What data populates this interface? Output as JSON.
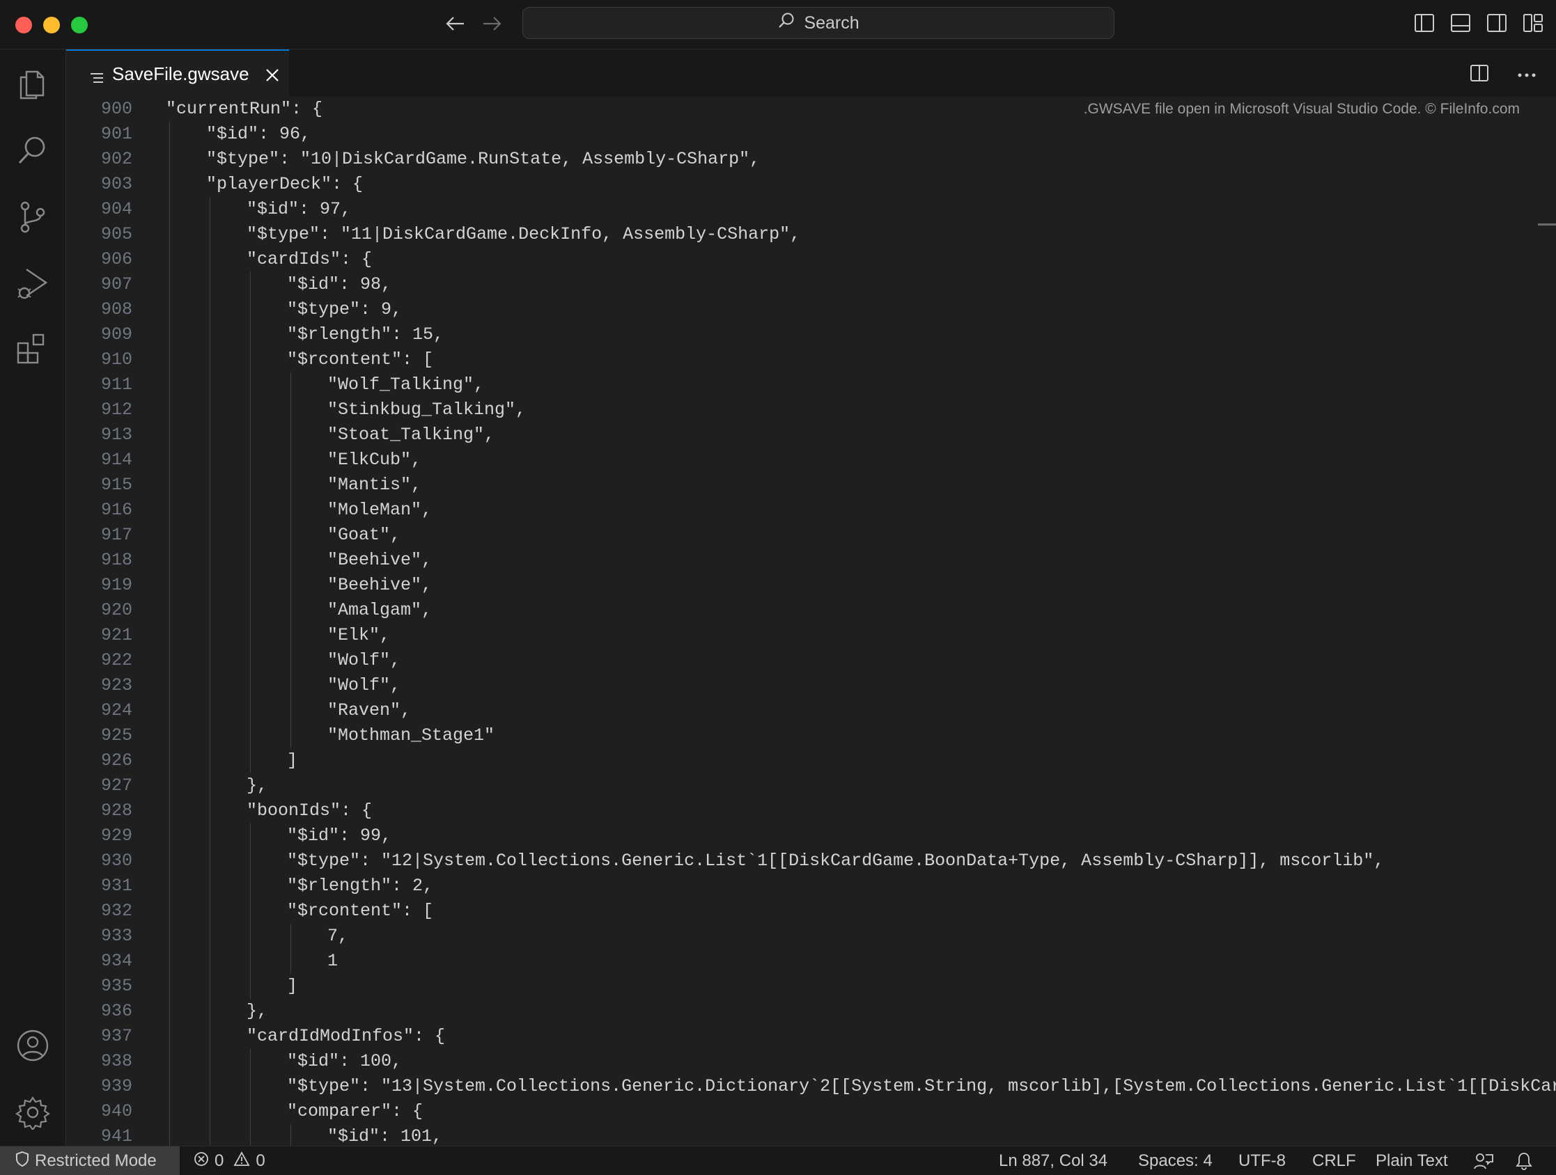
{
  "titlebar": {
    "search_label": "Search"
  },
  "tab": {
    "filename": "SaveFile.gwsave"
  },
  "editor": {
    "watermark": ".GWSAVE file open in Microsoft Visual Studio Code. © FileInfo.com",
    "lines": [
      {
        "n": "900",
        "indent": 1,
        "text": "\"currentRun\": {"
      },
      {
        "n": "901",
        "indent": 2,
        "text": "\"$id\": 96,"
      },
      {
        "n": "902",
        "indent": 2,
        "text": "\"$type\": \"10|DiskCardGame.RunState, Assembly-CSharp\","
      },
      {
        "n": "903",
        "indent": 2,
        "text": "\"playerDeck\": {"
      },
      {
        "n": "904",
        "indent": 3,
        "text": "\"$id\": 97,"
      },
      {
        "n": "905",
        "indent": 3,
        "text": "\"$type\": \"11|DiskCardGame.DeckInfo, Assembly-CSharp\","
      },
      {
        "n": "906",
        "indent": 3,
        "text": "\"cardIds\": {"
      },
      {
        "n": "907",
        "indent": 4,
        "text": "\"$id\": 98,"
      },
      {
        "n": "908",
        "indent": 4,
        "text": "\"$type\": 9,"
      },
      {
        "n": "909",
        "indent": 4,
        "text": "\"$rlength\": 15,"
      },
      {
        "n": "910",
        "indent": 4,
        "text": "\"$rcontent\": ["
      },
      {
        "n": "911",
        "indent": 5,
        "text": "\"Wolf_Talking\","
      },
      {
        "n": "912",
        "indent": 5,
        "text": "\"Stinkbug_Talking\","
      },
      {
        "n": "913",
        "indent": 5,
        "text": "\"Stoat_Talking\","
      },
      {
        "n": "914",
        "indent": 5,
        "text": "\"ElkCub\","
      },
      {
        "n": "915",
        "indent": 5,
        "text": "\"Mantis\","
      },
      {
        "n": "916",
        "indent": 5,
        "text": "\"MoleMan\","
      },
      {
        "n": "917",
        "indent": 5,
        "text": "\"Goat\","
      },
      {
        "n": "918",
        "indent": 5,
        "text": "\"Beehive\","
      },
      {
        "n": "919",
        "indent": 5,
        "text": "\"Beehive\","
      },
      {
        "n": "920",
        "indent": 5,
        "text": "\"Amalgam\","
      },
      {
        "n": "921",
        "indent": 5,
        "text": "\"Elk\","
      },
      {
        "n": "922",
        "indent": 5,
        "text": "\"Wolf\","
      },
      {
        "n": "923",
        "indent": 5,
        "text": "\"Wolf\","
      },
      {
        "n": "924",
        "indent": 5,
        "text": "\"Raven\","
      },
      {
        "n": "925",
        "indent": 5,
        "text": "\"Mothman_Stage1\""
      },
      {
        "n": "926",
        "indent": 4,
        "text": "]"
      },
      {
        "n": "927",
        "indent": 3,
        "text": "},"
      },
      {
        "n": "928",
        "indent": 3,
        "text": "\"boonIds\": {"
      },
      {
        "n": "929",
        "indent": 4,
        "text": "\"$id\": 99,"
      },
      {
        "n": "930",
        "indent": 4,
        "text": "\"$type\": \"12|System.Collections.Generic.List`1[[DiskCardGame.BoonData+Type, Assembly-CSharp]], mscorlib\","
      },
      {
        "n": "931",
        "indent": 4,
        "text": "\"$rlength\": 2,"
      },
      {
        "n": "932",
        "indent": 4,
        "text": "\"$rcontent\": ["
      },
      {
        "n": "933",
        "indent": 5,
        "text": "7,"
      },
      {
        "n": "934",
        "indent": 5,
        "text": "1"
      },
      {
        "n": "935",
        "indent": 4,
        "text": "]"
      },
      {
        "n": "936",
        "indent": 3,
        "text": "},"
      },
      {
        "n": "937",
        "indent": 3,
        "text": "\"cardIdModInfos\": {"
      },
      {
        "n": "938",
        "indent": 4,
        "text": "\"$id\": 100,"
      },
      {
        "n": "939",
        "indent": 4,
        "text": "\"$type\": \"13|System.Collections.Generic.Dictionary`2[[System.String, mscorlib],[System.Collections.Generic.List`1[[DiskCar"
      },
      {
        "n": "940",
        "indent": 4,
        "text": "\"comparer\": {"
      },
      {
        "n": "941",
        "indent": 5,
        "text": "\"$id\": 101,"
      }
    ]
  },
  "statusbar": {
    "restricted_mode": "Restricted Mode",
    "errors": "0",
    "warnings": "0",
    "cursor": "Ln 887, Col 34",
    "spaces": "Spaces: 4",
    "encoding": "UTF-8",
    "eol": "CRLF",
    "language": "Plain Text"
  }
}
